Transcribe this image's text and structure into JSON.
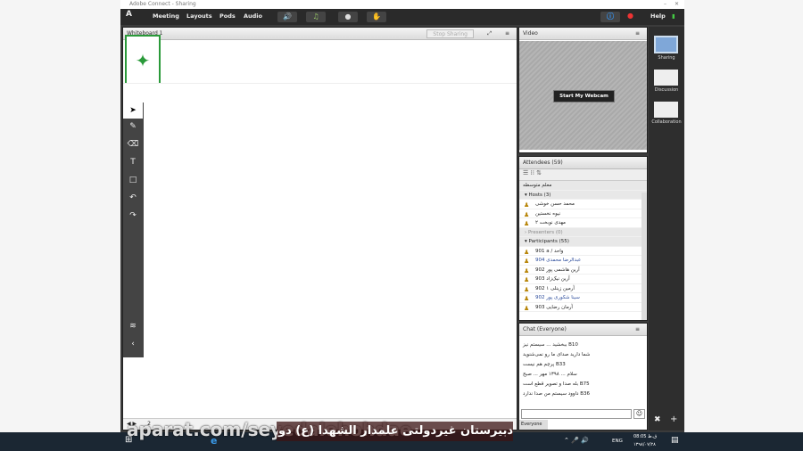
{
  "window": {
    "title": "Adobe Connect - Sharing"
  },
  "menu": {
    "items": [
      "Meeting",
      "Layouts",
      "Pods",
      "Audio"
    ],
    "help": "Help"
  },
  "whiteboard": {
    "title": "Whiteboard 1",
    "share_btn": "Stop Sharing",
    "page": "2"
  },
  "video": {
    "title": "Video",
    "start_button": "Start My Webcam"
  },
  "attendees": {
    "title": "Attendees (59)",
    "status": "معلم متوسطه",
    "groups": [
      {
        "label": "Hosts (3)",
        "items": [
          "محمد حسن خوشی",
          "نیوه نخستین",
          "مهدی نوبخت ۲"
        ]
      },
      {
        "label": "Presenters (0)",
        "items": []
      },
      {
        "label": "Participants (55)",
        "items": [
          "901 a / واحد",
          "904 عبدالرضا محمدی",
          "902 آرین هاشمی پور",
          "903 آرین نیک‌زاد",
          "902 آرمین زینلی ۱",
          "902 سینا شکوری پور",
          "903 آرمان رضایی"
        ]
      }
    ]
  },
  "chat": {
    "title": "Chat (Everyone)",
    "messages": [
      "B10 ببخشید ... سیستم نیز",
      "شما دارید صدای ما رو نمی‌شنوید",
      "B33 پرچم هم نیست",
      "سلام ... ۱۳۹۸ مهر ... صبح",
      "B75 بله صدا و تصویر قطع است",
      "B36 داوود سیستم من صدا ندارد"
    ],
    "tab": "Everyone"
  },
  "layouts": [
    "Sharing",
    "Discussion",
    "Collaboration"
  ],
  "watermark": {
    "site": "aparat.com/seyedalehohdae",
    "caption": "دبیرستان غیردولتی علمدار الشهدا (ع) دوره اول"
  },
  "taskbar": {
    "time": "08:05 ق.ظ",
    "date": "۱۳۹۸/۰۷/۲۸",
    "lang": "ENG"
  }
}
